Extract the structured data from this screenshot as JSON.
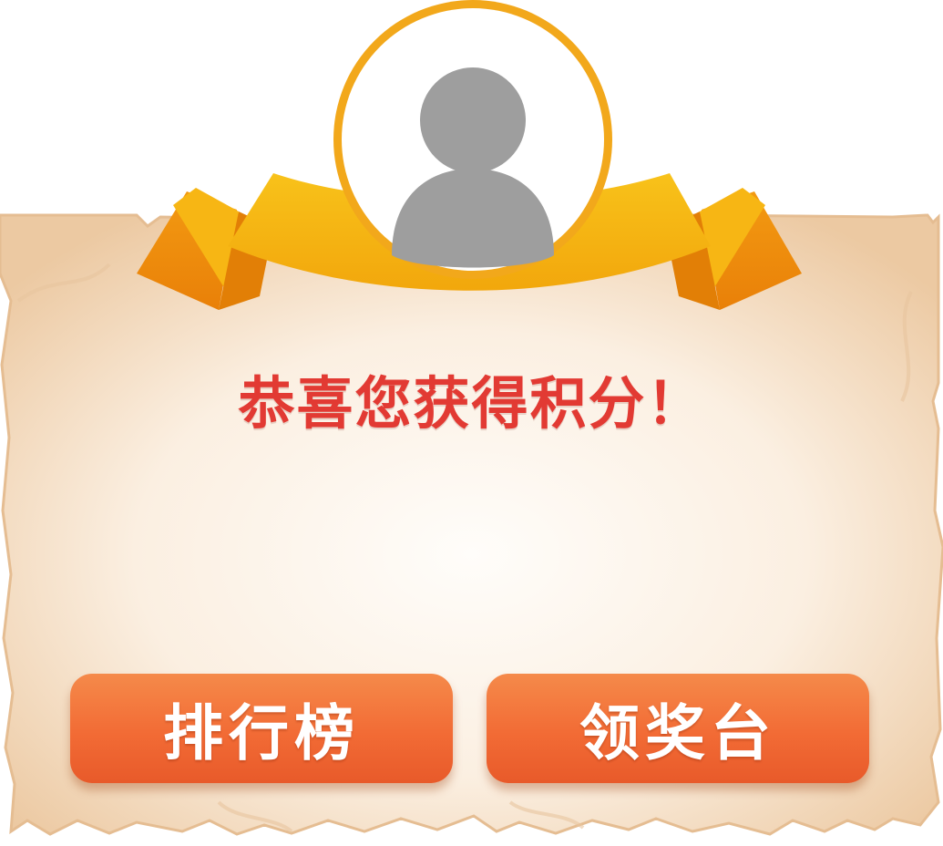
{
  "dialog": {
    "title": "恭喜您获得积分！"
  },
  "buttons": {
    "leaderboard_label": "排行榜",
    "prize_label": "领奖台"
  },
  "avatar": {
    "icon": "user-placeholder-icon"
  },
  "colors": {
    "title": "#e23a33",
    "button": "#f26b35",
    "ribbon": "#f5b70f",
    "avatar_ring": "#f2a81b",
    "avatar_silhouette": "#9e9e9e",
    "parchment": "#f3dcc0"
  }
}
